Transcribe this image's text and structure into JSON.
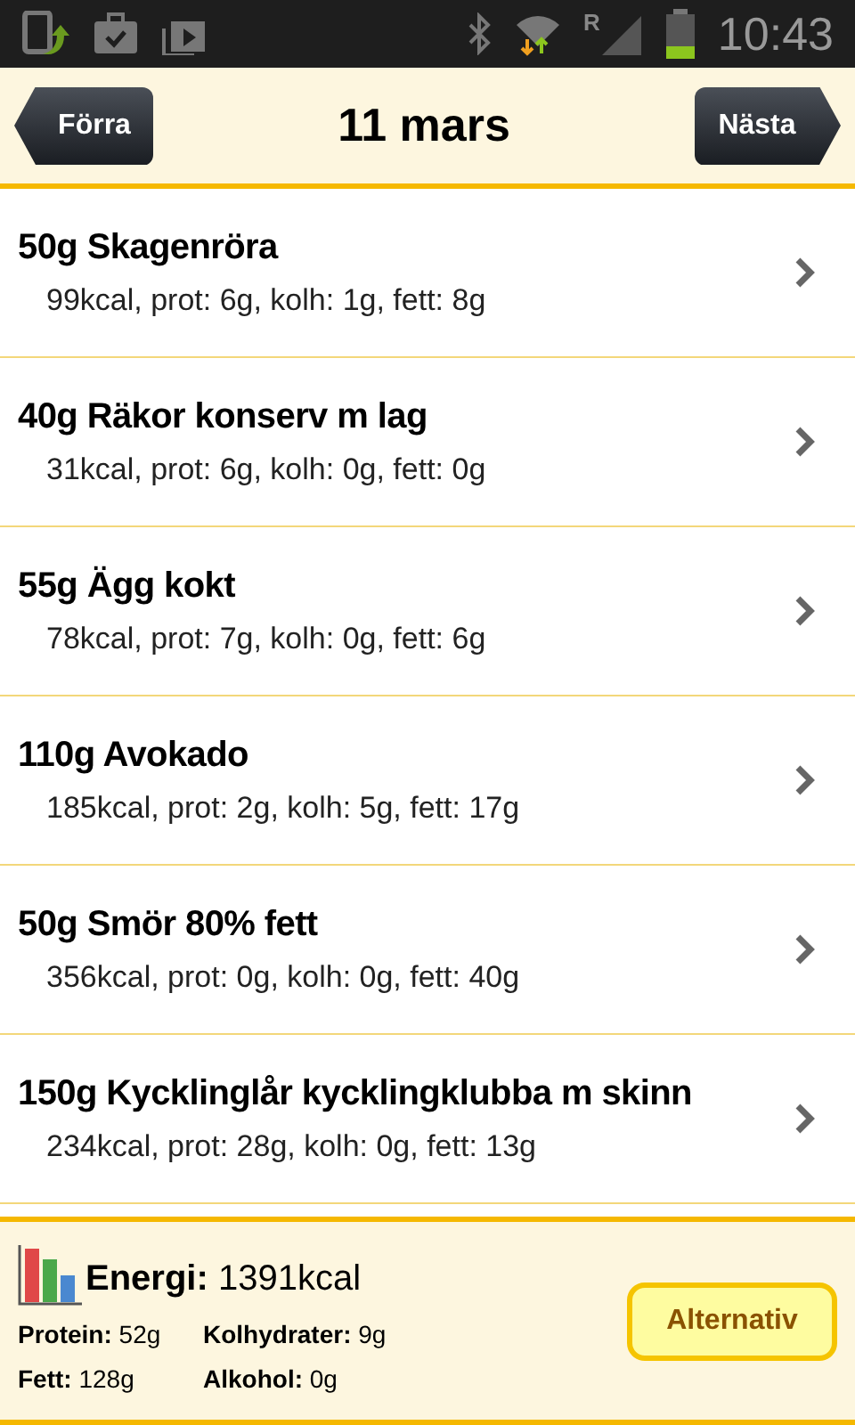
{
  "status_bar": {
    "network": "R",
    "time": "10:43"
  },
  "header": {
    "prev": "Förra",
    "title": "11 mars",
    "next": "Nästa"
  },
  "items": [
    {
      "title": "50g Skagenröra",
      "details": "99kcal, prot: 6g, kolh: 1g, fett: 8g"
    },
    {
      "title": "40g Räkor konserv m lag",
      "details": "31kcal, prot: 6g, kolh: 0g, fett: 0g"
    },
    {
      "title": "55g Ägg kokt",
      "details": "78kcal, prot: 7g, kolh: 0g, fett: 6g"
    },
    {
      "title": "110g Avokado",
      "details": "185kcal, prot: 2g, kolh: 5g, fett: 17g"
    },
    {
      "title": "50g Smör 80% fett",
      "details": "356kcal, prot: 0g, kolh: 0g, fett: 40g"
    },
    {
      "title": "150g Kycklinglår kycklingklubba m skinn",
      "details": "234kcal, prot: 28g, kolh: 0g, fett: 13g"
    }
  ],
  "summary": {
    "energy": "**Energi:** 1391kcal",
    "stats": [
      "**Protein:** 52g",
      "**Kolhydrater:** 9g",
      "**Fett:** 128g",
      "**Alkohol:** 0g"
    ],
    "button": "Alternativ"
  }
}
